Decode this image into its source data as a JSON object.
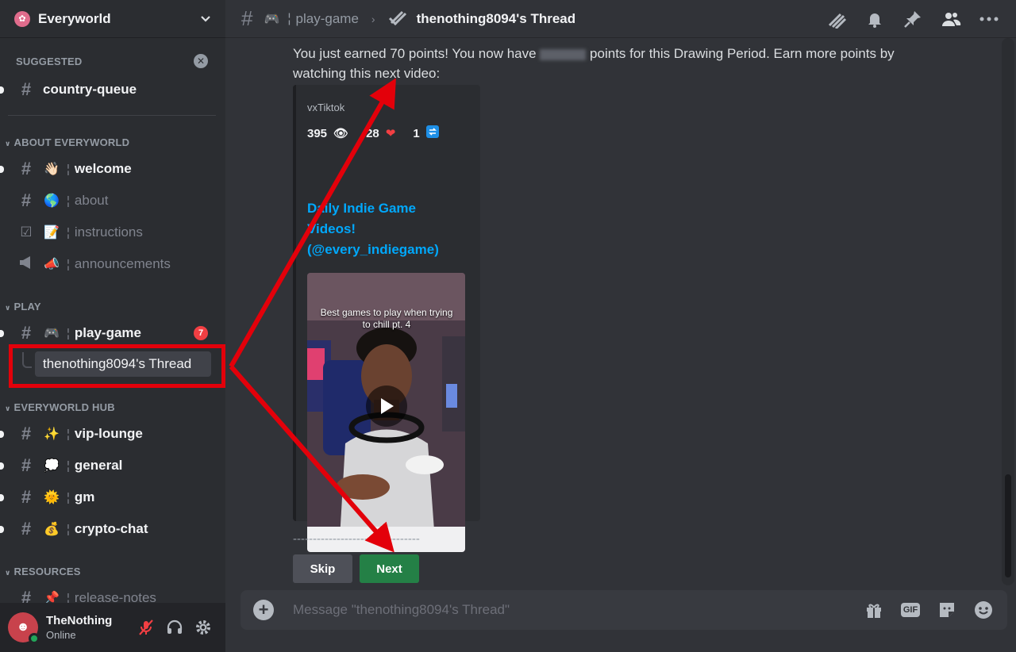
{
  "server": {
    "name": "Everyworld"
  },
  "sidebar": {
    "suggested": {
      "title": "SUGGESTED",
      "items": [
        {
          "name": "country-queue"
        }
      ]
    },
    "categories": [
      {
        "title": "ABOUT EVERYWORLD",
        "channels": [
          {
            "emoji": "👋🏻",
            "name": "welcome"
          },
          {
            "emoji": "🌎",
            "name": "about"
          },
          {
            "emoji": "📝",
            "name": "instructions"
          },
          {
            "emoji": "📣",
            "name": "announcements"
          }
        ]
      },
      {
        "title": "PLAY",
        "channels": [
          {
            "emoji": "🎮",
            "name": "play-game",
            "badge": "7"
          }
        ]
      },
      {
        "title": "EVERYWORLD HUB",
        "channels": [
          {
            "emoji": "✨",
            "name": "vip-lounge"
          },
          {
            "emoji": "💭",
            "name": "general"
          },
          {
            "emoji": "🌞",
            "name": "gm"
          },
          {
            "emoji": "💰",
            "name": "crypto-chat"
          }
        ]
      },
      {
        "title": "RESOURCES",
        "channels": [
          {
            "emoji": "📌",
            "name": "release-notes"
          }
        ]
      }
    ],
    "thread": {
      "name": "thenothing8094's Thread"
    },
    "separator": "¦"
  },
  "user": {
    "name": "TheNothing",
    "status": "Online"
  },
  "header": {
    "parent_channel": "play-game",
    "parent_emoji": "🎮",
    "thread_title": "thenothing8094's Thread"
  },
  "message": {
    "text_before": "You just earned 70 points! You now have",
    "text_after": "points for this Drawing Period. Earn more points by watching this next video:",
    "embed": {
      "provider": "vxTiktok",
      "views": "395",
      "likes": "28",
      "shares": "1",
      "title": "Daily Indie Game Videos! (@every_indiegame)",
      "video_caption": "Best games to play when trying to chill pt. 4"
    },
    "divider": "--------------------------------",
    "buttons": {
      "skip": "Skip",
      "next": "Next"
    }
  },
  "composer": {
    "placeholder": "Message \"thenothing8094's Thread\"",
    "gif_label": "GIF"
  },
  "colors": {
    "annotation": "#e3000a",
    "accent_link": "#00a8fc",
    "next_button": "#248046",
    "badge": "#f23f43"
  }
}
